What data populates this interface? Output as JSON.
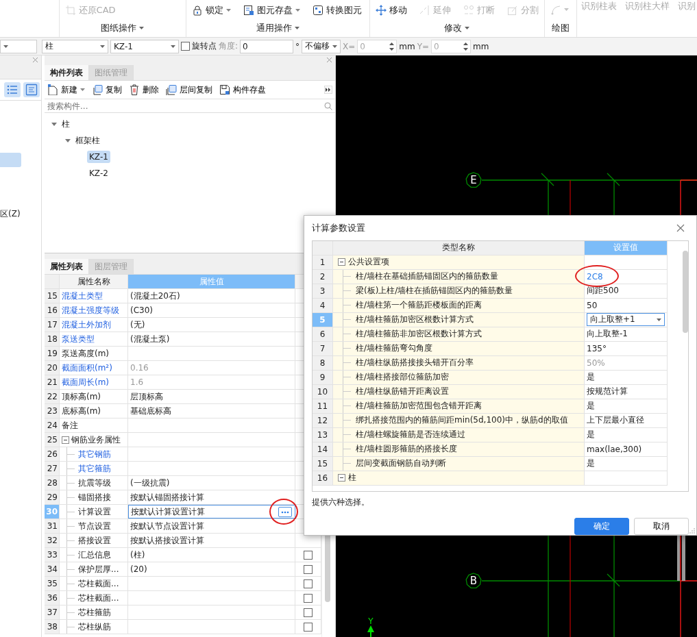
{
  "ribbon": {
    "groups": [
      {
        "label": "图纸操作",
        "menu": true,
        "buttons": [
          {
            "label": "还原CAD",
            "disabled": true,
            "menu": false
          }
        ]
      },
      {
        "label": "通用操作",
        "menu": true,
        "buttons": [
          {
            "label": "锁定",
            "disabled": false,
            "menu": true
          },
          {
            "label": "图元存盘",
            "disabled": false,
            "menu": true
          },
          {
            "label": "转换图元",
            "disabled": false,
            "menu": false
          }
        ]
      },
      {
        "label": "修改",
        "menu": true,
        "buttons": [
          {
            "label": "移动",
            "disabled": false,
            "menu": false
          },
          {
            "label": "延伸",
            "disabled": true,
            "menu": false
          },
          {
            "label": "打断",
            "disabled": true,
            "menu": false
          },
          {
            "label": "分割",
            "disabled": true,
            "menu": false
          }
        ]
      },
      {
        "label": "绘图",
        "menu": false,
        "buttons": [
          {
            "disabled": true,
            "menu": true
          }
        ]
      }
    ],
    "extra_buttons": [
      {
        "label": "识别柱表",
        "disabled": true
      },
      {
        "label": "识别柱大样",
        "disabled": true
      },
      {
        "label": "识别",
        "disabled": true
      }
    ]
  },
  "toolbar": {
    "type_select": "柱",
    "component_select": "KZ-1",
    "rotate_point": {
      "label": "旋转点",
      "checked": false
    },
    "angle": {
      "label": "角度:",
      "value": "0",
      "unit": "°"
    },
    "offset_select": "不偏移",
    "x": {
      "label": "X=",
      "value": "0",
      "unit": "mm",
      "disabled": true
    },
    "y": {
      "label": "Y=",
      "value": "0",
      "unit": "mm",
      "disabled": true
    }
  },
  "left_panel": {
    "view_buttons": [
      {
        "selected": true
      },
      {
        "selected": true
      }
    ],
    "items": [
      {
        "selected": true
      },
      {
        "label": "区(Z)",
        "selected": false
      }
    ]
  },
  "component_panel": {
    "tabs": [
      {
        "label": "构件列表",
        "selected": true
      },
      {
        "label": "图纸管理",
        "selected": false
      }
    ],
    "toolbar": [
      {
        "label": "新建",
        "menu": true
      },
      {
        "label": "复制",
        "menu": false
      },
      {
        "label": "删除",
        "menu": false
      },
      {
        "label": "层间复制",
        "menu": false
      },
      {
        "label": "构件存盘",
        "menu": false
      }
    ],
    "search": {
      "placeholder": "搜索构件..."
    },
    "tree": [
      {
        "label": "柱",
        "expanded": true,
        "selected": false,
        "children": [
          {
            "label": "框架柱",
            "expanded": true,
            "selected": false,
            "children": [
              {
                "label": "KZ-1",
                "selected": true
              },
              {
                "label": "KZ-2",
                "selected": false
              }
            ]
          }
        ]
      }
    ]
  },
  "property_panel": {
    "tabs": [
      {
        "label": "属性列表",
        "selected": true
      },
      {
        "label": "图层管理",
        "selected": false
      }
    ],
    "columns": [
      "属性名称",
      "属性值"
    ],
    "rows": [
      {
        "num": "15",
        "name": "混凝土类型",
        "value": "(混凝土20石)",
        "public": true,
        "readonly": false,
        "selected": false
      },
      {
        "num": "16",
        "name": "混凝土强度等级",
        "value": "(C30)",
        "public": true,
        "readonly": false,
        "selected": false
      },
      {
        "num": "17",
        "name": "混凝土外加剂",
        "value": "(无)",
        "public": true,
        "readonly": false,
        "selected": false
      },
      {
        "num": "18",
        "name": "泵送类型",
        "value": "(混凝土泵)",
        "public": true,
        "readonly": false,
        "selected": false
      },
      {
        "num": "19",
        "name": "泵送高度(m)",
        "public": false,
        "selected": false
      },
      {
        "num": "20",
        "name": "截面面积(m²)",
        "value": "0.16",
        "public": true,
        "readonly": true,
        "selected": false
      },
      {
        "num": "21",
        "name": "截面周长(m)",
        "value": "1.6",
        "public": true,
        "readonly": true,
        "selected": false
      },
      {
        "num": "22",
        "name": "顶标高(m)",
        "value": "层顶标高",
        "public": false,
        "readonly": false,
        "selected": false
      },
      {
        "num": "23",
        "name": "底标高(m)",
        "value": "基础底标高",
        "public": false,
        "readonly": false,
        "selected": false
      },
      {
        "num": "24",
        "name": "备注",
        "public": false,
        "selected": false
      },
      {
        "num": "25",
        "name": "钢筋业务属性",
        "public": false,
        "selected": false,
        "expanded": true,
        "children": [
          {
            "num": "26",
            "name": "其它钢筋",
            "public": true,
            "selected": false
          },
          {
            "num": "27",
            "name": "其它箍筋",
            "public": true,
            "selected": false
          },
          {
            "num": "28",
            "name": "抗震等级",
            "value": "(一级抗震)",
            "public": false,
            "readonly": false,
            "selected": false
          },
          {
            "num": "29",
            "name": "锚固搭接",
            "value": "按默认锚固搭接计算",
            "public": false,
            "readonly": false,
            "selected": false
          },
          {
            "num": "30",
            "name": "计算设置",
            "value": "按默认计算设置计算",
            "public": false,
            "readonly": false,
            "selected": true,
            "circled": true
          },
          {
            "num": "31",
            "name": "节点设置",
            "value": "按默认节点设置计算",
            "public": false,
            "readonly": false,
            "selected": false
          },
          {
            "num": "32",
            "name": "搭接设置",
            "value": "按默认搭接设置计算",
            "public": false,
            "readonly": false,
            "selected": false
          },
          {
            "num": "33",
            "name": "汇总信息",
            "value": "(柱)",
            "public": false,
            "readonly": false,
            "selected": false,
            "checked": false
          },
          {
            "num": "34",
            "name": "保护层厚...",
            "value": "(20)",
            "public": false,
            "readonly": false,
            "selected": false,
            "checked": false
          },
          {
            "num": "35",
            "name": "芯柱截面...",
            "public": false,
            "selected": false,
            "checked": false
          },
          {
            "num": "36",
            "name": "芯柱截面...",
            "public": false,
            "selected": false,
            "checked": false
          },
          {
            "num": "37",
            "name": "芯柱箍筋",
            "public": false,
            "selected": false,
            "checked": false
          },
          {
            "num": "38",
            "name": "芯柱纵筋",
            "public": false,
            "selected": false,
            "checked": false
          }
        ]
      }
    ]
  },
  "canvas": {
    "grid_labels": [
      "E",
      "B"
    ],
    "axis_label": "Y"
  },
  "dialog": {
    "title": "计算参数设置",
    "columns": [
      "类型名称",
      "设置值"
    ],
    "rows": [
      {
        "num": "1",
        "name": "公共设置项",
        "expanded": true,
        "selected": false,
        "children": [
          {
            "num": "2",
            "name": "柱/墙柱在基础插筋锚固区内的箍筋数量",
            "value": "2C8",
            "kind": "link",
            "disabled": false,
            "selected": false,
            "circled": true
          },
          {
            "num": "3",
            "name": "梁(板)上柱/墙柱在插筋锚固区内的箍筋数量",
            "value": "间距500",
            "kind": "text",
            "disabled": false,
            "selected": false
          },
          {
            "num": "4",
            "name": "柱/墙柱第一个箍筋距楼板面的距离",
            "value": "50",
            "kind": "text",
            "disabled": false,
            "selected": false
          },
          {
            "num": "5",
            "name": "柱/墙柱箍筋加密区根数计算方式",
            "value": "向上取整+1",
            "kind": "dropdown",
            "disabled": false,
            "selected": true
          },
          {
            "num": "6",
            "name": "柱/墙柱箍筋非加密区根数计算方式",
            "value": "向上取整-1",
            "kind": "text",
            "disabled": false,
            "selected": false
          },
          {
            "num": "7",
            "name": "柱/墙柱箍筋弯勾角度",
            "value": "135°",
            "kind": "text",
            "disabled": false,
            "selected": false
          },
          {
            "num": "8",
            "name": "柱/墙柱纵筋搭接接头错开百分率",
            "value": "50%",
            "kind": "text",
            "disabled": true,
            "selected": false
          },
          {
            "num": "9",
            "name": "柱/墙柱搭接部位箍筋加密",
            "value": "是",
            "kind": "text",
            "disabled": false,
            "selected": false
          },
          {
            "num": "10",
            "name": "柱/墙柱纵筋错开距离设置",
            "value": "按规范计算",
            "kind": "text",
            "disabled": false,
            "selected": false
          },
          {
            "num": "11",
            "name": "柱/墙柱箍筋加密范围包含错开距离",
            "value": "是",
            "kind": "text",
            "disabled": false,
            "selected": false
          },
          {
            "num": "12",
            "name": "绑扎搭接范围内的箍筋间距min(5d,100)中，纵筋d的取值",
            "value": "上下层最小直径",
            "kind": "text",
            "disabled": false,
            "selected": false
          },
          {
            "num": "13",
            "name": "柱/墙柱螺旋箍筋是否连续通过",
            "value": "是",
            "kind": "text",
            "disabled": false,
            "selected": false
          },
          {
            "num": "14",
            "name": "柱/墙柱圆形箍筋的搭接长度",
            "value": "max(lae,300)",
            "kind": "text",
            "disabled": false,
            "selected": false
          },
          {
            "num": "15",
            "name": "层间变截面钢筋自动判断",
            "value": "是",
            "kind": "text",
            "disabled": false,
            "selected": false
          }
        ]
      },
      {
        "num": "16",
        "name": "柱",
        "expanded": true,
        "selected": false
      }
    ],
    "hint": "提供六种选择。",
    "buttons": [
      {
        "label": "确定",
        "primary": true
      },
      {
        "label": "取消",
        "primary": false
      }
    ]
  }
}
